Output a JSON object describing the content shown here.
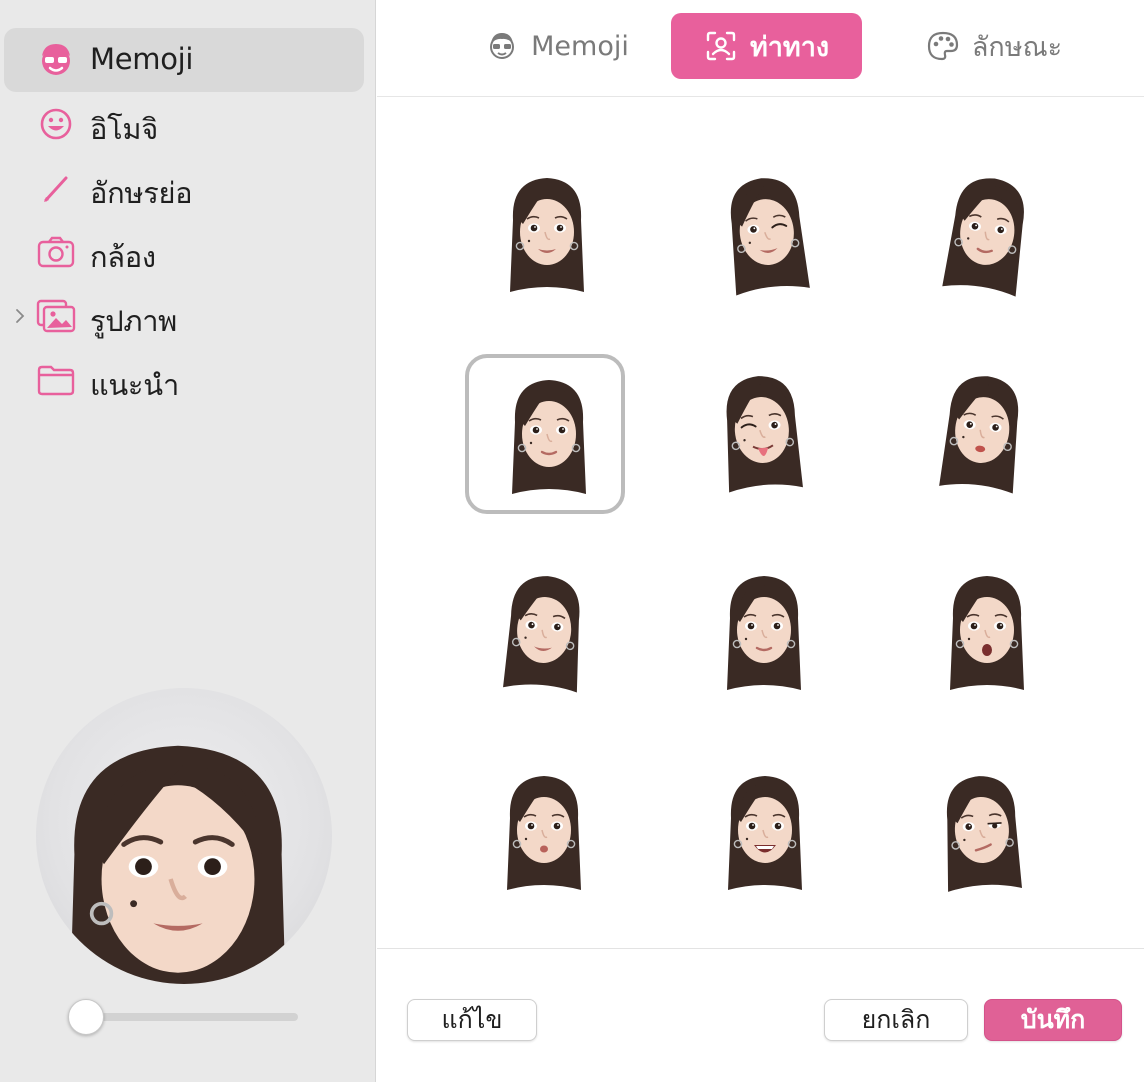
{
  "sidebar": {
    "items": [
      {
        "label": "Memoji",
        "icon": "memoji-face-icon",
        "selected": true
      },
      {
        "label": "อิโมจิ",
        "icon": "smiley-icon"
      },
      {
        "label": "อักษรย่อ",
        "icon": "pencil-icon"
      },
      {
        "label": "กล้อง",
        "icon": "camera-icon"
      },
      {
        "label": "รูปภาพ",
        "icon": "photos-icon",
        "expandable": true
      },
      {
        "label": "แนะนำ",
        "icon": "folder-icon"
      }
    ],
    "preview": {
      "icon": "memoji-avatar-preview",
      "zoom_level": 0.0
    }
  },
  "tabs": [
    {
      "label": "Memoji",
      "icon": "memoji-face-icon",
      "active": false
    },
    {
      "label": "ท่าทาง",
      "icon": "person-frame-icon",
      "active": true
    },
    {
      "label": "ลักษณะ",
      "icon": "palette-icon",
      "active": false
    }
  ],
  "poses": [
    {
      "name": "pose-smile"
    },
    {
      "name": "pose-wink-smile"
    },
    {
      "name": "pose-tilt"
    },
    {
      "name": "pose-neutral",
      "selected": true
    },
    {
      "name": "pose-tongue-wink"
    },
    {
      "name": "pose-pout-tilt"
    },
    {
      "name": "pose-soft-smile"
    },
    {
      "name": "pose-grin"
    },
    {
      "name": "pose-surprised"
    },
    {
      "name": "pose-kiss"
    },
    {
      "name": "pose-laugh"
    },
    {
      "name": "pose-skeptical"
    }
  ],
  "buttons": {
    "edit": "แก้ไข",
    "cancel": "ยกเลิก",
    "save": "บันทึก"
  },
  "colors": {
    "accent": "#e8609c",
    "sidebar_bg": "#e9e9e9",
    "hair": "#3a2a24",
    "skin": "#f3d8c8"
  }
}
